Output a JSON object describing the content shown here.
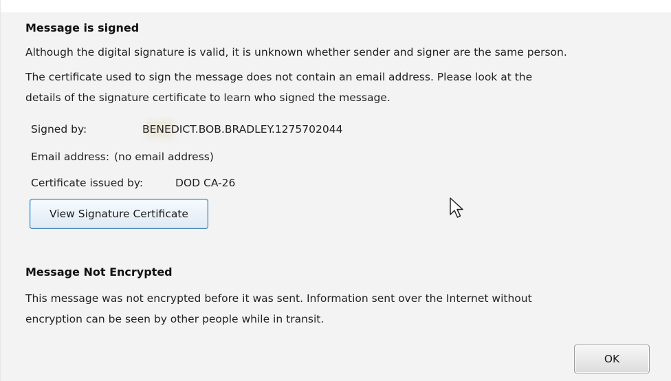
{
  "signed_section": {
    "title": "Message is signed",
    "line1": "Although the digital signature is valid, it is unknown whether sender and signer are the same person.",
    "line2": "The certificate used to sign the message does not contain an email address. Please look at the",
    "line3": "details of the signature certificate to learn who signed the message."
  },
  "details": {
    "signed_by_label": "Signed by:",
    "signed_by_value": "BENEDICT.BOB.BRADLEY.1275702044",
    "email_label": "Email address:",
    "email_value": "(no email address)",
    "issuer_label": "Certificate issued by:",
    "issuer_value": "DOD CA-26"
  },
  "buttons": {
    "view_certificate": "View Signature Certificate",
    "ok": "OK"
  },
  "encryption_section": {
    "title": "Message Not Encrypted",
    "line1": "This message was not encrypted before it was sent. Information sent over the Internet without",
    "line2": "encryption can be seen by other people while in transit."
  },
  "icons": {
    "cursor": "mouse-pointer-icon"
  }
}
